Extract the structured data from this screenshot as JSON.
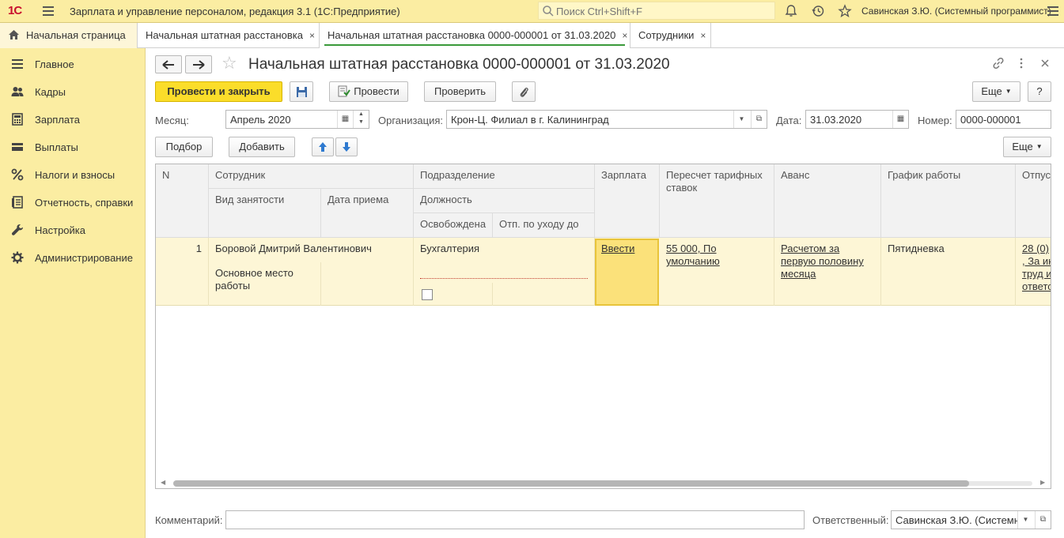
{
  "topbar": {
    "logo": "1С",
    "title": "Зарплата и управление персоналом, редакция 3.1  (1С:Предприятие)",
    "search_placeholder": "Поиск Ctrl+Shift+F",
    "user": "Савинская З.Ю. (Системный программист)"
  },
  "tabs": [
    {
      "label": "Начальная страница"
    },
    {
      "label": "Начальная штатная расстановка",
      "close": "×"
    },
    {
      "label": "Начальная штатная расстановка 0000-000001 от 31.03.2020",
      "close": "×"
    },
    {
      "label": "Сотрудники",
      "close": "×"
    }
  ],
  "sidebar": {
    "items": [
      {
        "label": "Главное",
        "icon": "list-icon"
      },
      {
        "label": "Кадры",
        "icon": "people-icon"
      },
      {
        "label": "Зарплата",
        "icon": "calculator-icon"
      },
      {
        "label": "Выплаты",
        "icon": "wallet-icon"
      },
      {
        "label": "Налоги и взносы",
        "icon": "percent-icon"
      },
      {
        "label": "Отчетность, справки",
        "icon": "report-icon"
      },
      {
        "label": "Настройка",
        "icon": "wrench-icon"
      },
      {
        "label": "Администрирование",
        "icon": "gear-icon"
      }
    ]
  },
  "document": {
    "title": "Начальная штатная расстановка 0000-000001 от 31.03.2020",
    "buttons": {
      "post_close": "Провести и закрыть",
      "post": "Провести",
      "check": "Проверить",
      "more": "Еще",
      "help": "?",
      "pick": "Подбор",
      "add": "Добавить",
      "more2": "Еще"
    },
    "fields": {
      "month_label": "Месяц:",
      "month_value": "Апрель 2020",
      "org_label": "Организация:",
      "org_value": "Крон-Ц. Филиал в г. Калининград",
      "date_label": "Дата:",
      "date_value": "31.03.2020",
      "number_label": "Номер:",
      "number_value": "0000-000001"
    },
    "table": {
      "headers": {
        "n": "N",
        "employee": "Сотрудник",
        "employment_type": "Вид занятости",
        "hire_date": "Дата приема",
        "department": "Подразделение",
        "position": "Должность",
        "released": "Освобождена",
        "leave_until": "Отп. по уходу до",
        "salary": "Зарплата",
        "recalc": "Пересчет тарифных ставок",
        "advance": "Аванс",
        "schedule": "График работы",
        "vacation": "Отпус"
      },
      "rows": [
        {
          "n": "1",
          "employee": "Боровой Дмитрий Валентинович",
          "employment_type": "Основное место работы",
          "department": "Бухгалтерия",
          "salary": "Ввести",
          "recalc": "55 000, По умолчанию",
          "advance": "Расчетом за первую половину месяца",
          "schedule": "Пятидневка",
          "vacation_1": "28 (0)",
          "vacation_2": ", За ин",
          "vacation_3": "труд и",
          "vacation_4": "ответс"
        }
      ]
    },
    "footer": {
      "comment_label": "Комментарий:",
      "responsible_label": "Ответственный:",
      "responsible_value": "Савинская З.Ю. (Системн"
    }
  }
}
